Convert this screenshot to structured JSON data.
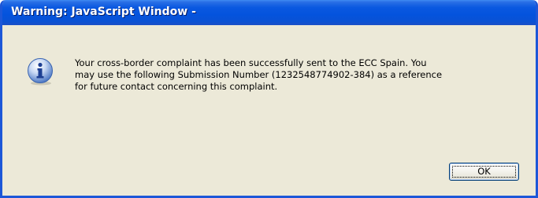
{
  "window": {
    "title": "Warning: JavaScript Window -"
  },
  "dialog": {
    "icon": "info-icon",
    "message_lines": [
      "Your cross-border complaint has been successfully sent to the ECC Spain. You",
      "may use the following Submission Number (1232548774902-384) as a reference",
      "for future contact concerning this complaint."
    ],
    "ok_label": "OK"
  },
  "colors": {
    "titlebar": "#0453dd",
    "body": "#ece9d8",
    "border": "#1c57d8"
  }
}
